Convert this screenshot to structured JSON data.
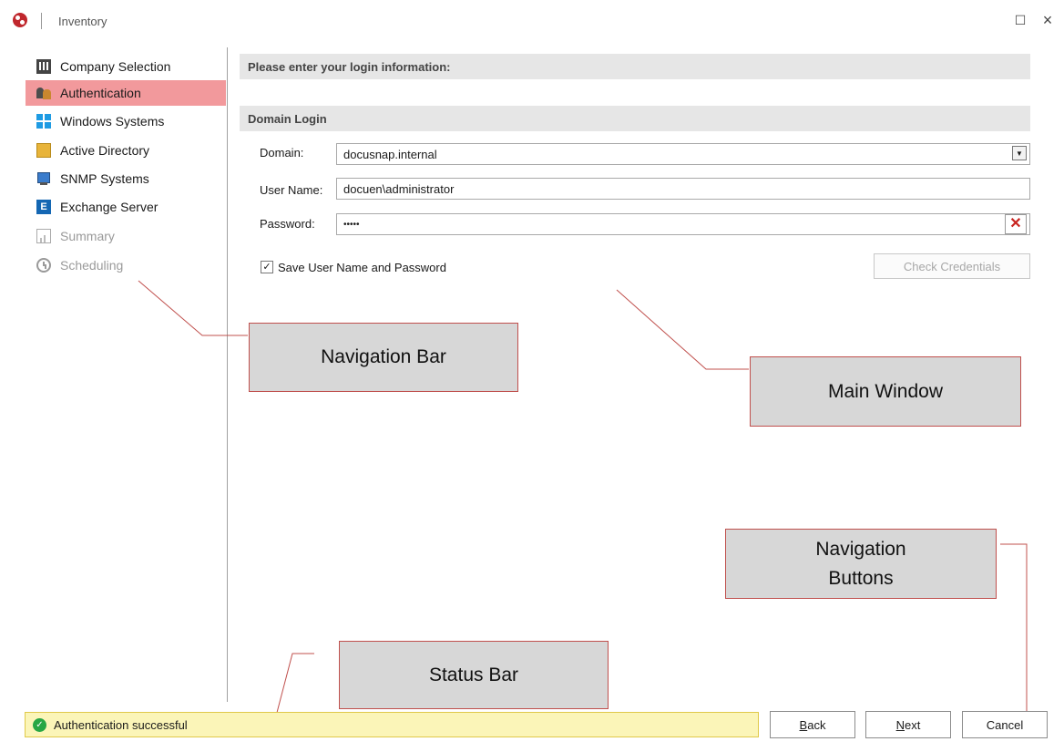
{
  "window": {
    "title": "Inventory"
  },
  "nav": {
    "items": [
      {
        "label": "Company Selection",
        "icon": "building-icon",
        "state": "normal"
      },
      {
        "label": "Authentication",
        "icon": "users-icon",
        "state": "active"
      },
      {
        "label": "Windows Systems",
        "icon": "windows-icon",
        "state": "normal"
      },
      {
        "label": "Active Directory",
        "icon": "active-directory-icon",
        "state": "normal"
      },
      {
        "label": "SNMP Systems",
        "icon": "snmp-icon",
        "state": "normal"
      },
      {
        "label": "Exchange Server",
        "icon": "exchange-icon",
        "state": "normal"
      },
      {
        "label": "Summary",
        "icon": "summary-icon",
        "state": "disabled"
      },
      {
        "label": "Scheduling",
        "icon": "clock-icon",
        "state": "disabled"
      }
    ]
  },
  "main": {
    "header": "Please enter your login information:",
    "domain_login": {
      "title": "Domain Login",
      "domain_label": "Domain:",
      "domain_value": "docusnap.internal",
      "username_label": "User Name:",
      "username_value": "docuen\\administrator",
      "password_label": "Password:",
      "password_value": "•••••",
      "save_checkbox_label": "Save User Name and Password",
      "save_checked": true,
      "check_credentials_label": "Check Credentials"
    }
  },
  "callouts": {
    "navigation_bar": "Navigation Bar",
    "main_window": "Main Window",
    "navigation_buttons_line1": "Navigation",
    "navigation_buttons_line2": "Buttons",
    "status_bar": "Status Bar"
  },
  "status": {
    "text": "Authentication successful"
  },
  "buttons": {
    "back_mnemonic": "B",
    "back_rest": "ack",
    "next_mnemonic": "N",
    "next_rest": "ext",
    "cancel": "Cancel"
  },
  "colors": {
    "active_nav": "#f2999c",
    "callout_border": "#c0504d",
    "status_bg": "#fbf5b8"
  }
}
